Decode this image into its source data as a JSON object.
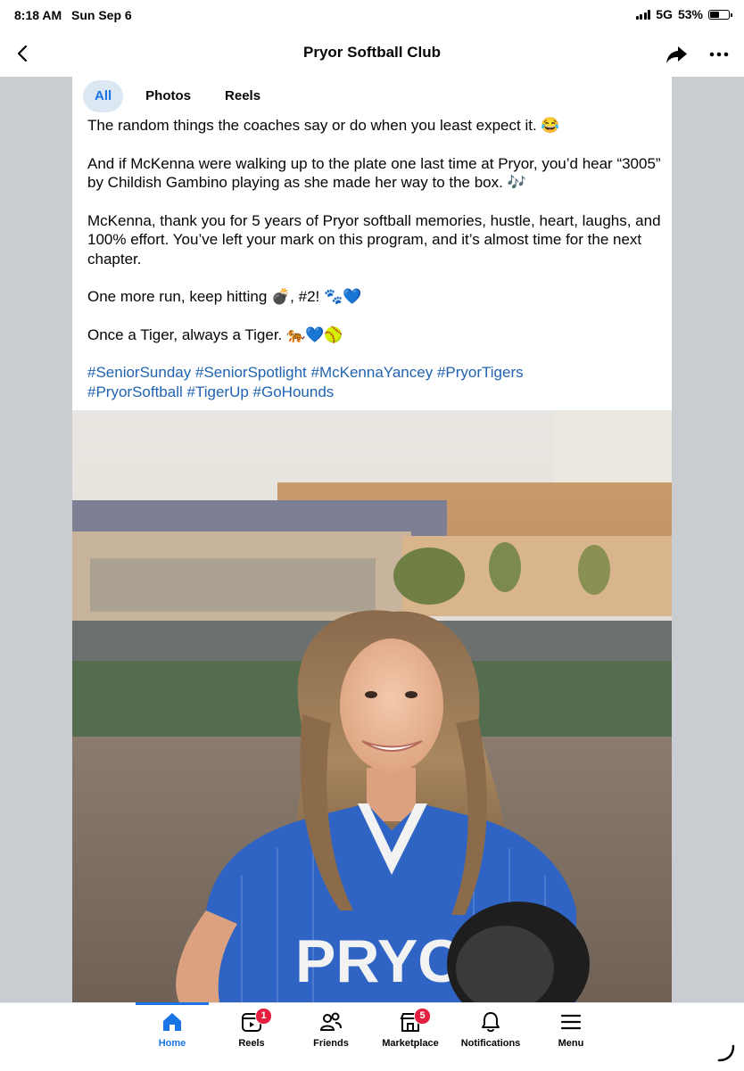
{
  "status_bar": {
    "time": "8:18 AM",
    "date": "Sun Sep 6",
    "network": "5G",
    "battery": "53%",
    "battery_level": 0.53
  },
  "header": {
    "title": "Pryor Softball Club"
  },
  "tabs": [
    {
      "label": "All",
      "active": true
    },
    {
      "label": "Photos",
      "active": false
    },
    {
      "label": "Reels",
      "active": false
    }
  ],
  "post": {
    "p1": "The random things the coaches say or do when you least expect it. 😂",
    "p2": "And if McKenna were walking up to the plate one last time at Pryor, you’d hear “3005” by Childish Gambino playing as she made her way to the box. 🎶",
    "p3": "McKenna, thank you for 5 years of Pryor softball memories, hustle, heart, laughs, and 100% effort. You’ve left your mark on this program, and it’s almost time for the next chapter.",
    "p4": "One more run, keep hitting 💣, #2! 🐾💙",
    "p5": "Once a Tiger, always a Tiger. 🐅💙🥎",
    "hashtags": [
      "#SeniorSunday",
      "#SeniorSpotlight",
      "#McKennaYancey",
      "#PryorTigers",
      "#PryorSoftball",
      "#TigerUp",
      "#GoHounds"
    ]
  },
  "photo": {
    "jersey_text": "PRYO"
  },
  "bottom_nav": [
    {
      "label": "Home",
      "icon": "home-icon",
      "badge": ""
    },
    {
      "label": "Reels",
      "icon": "reels-icon",
      "badge": "1"
    },
    {
      "label": "Friends",
      "icon": "friends-icon",
      "badge": ""
    },
    {
      "label": "Marketplace",
      "icon": "marketplace-icon",
      "badge": "5"
    },
    {
      "label": "Notifications",
      "icon": "bell-icon",
      "badge": ""
    },
    {
      "label": "Menu",
      "icon": "menu-icon",
      "badge": ""
    }
  ],
  "colors": {
    "accent": "#1b74e4",
    "hashtag": "#2063b0",
    "badge": "#e41e3f",
    "gutter": "#c9ccd1"
  }
}
